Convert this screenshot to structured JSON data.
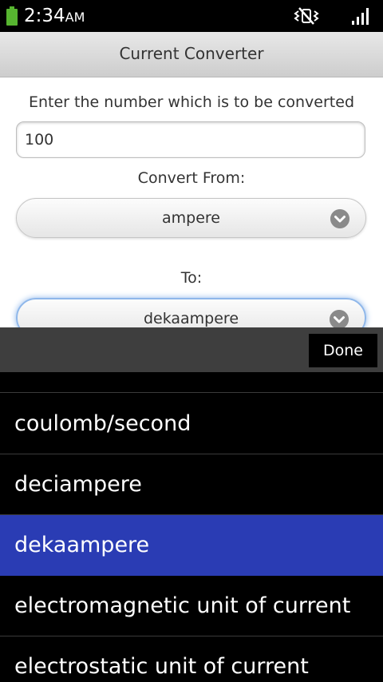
{
  "status_bar": {
    "time": "2:34",
    "ampm": "AM"
  },
  "title": "Current Converter",
  "form": {
    "number_label": "Enter the number which is to be converted",
    "number_value": "100",
    "from_label": "Convert From:",
    "from_value": "ampere",
    "to_label": "To:",
    "to_value": "dekaampere"
  },
  "picker": {
    "done_label": "Done",
    "items": [
      {
        "label": "coulomb/second",
        "selected": false
      },
      {
        "label": "deciampere",
        "selected": false
      },
      {
        "label": "dekaampere",
        "selected": true
      },
      {
        "label": "electromagnetic unit of current",
        "selected": false
      },
      {
        "label": "electrostatic unit of current",
        "selected": false
      }
    ]
  },
  "colors": {
    "selected": "#2a3cb4",
    "battery": "#57b530"
  }
}
